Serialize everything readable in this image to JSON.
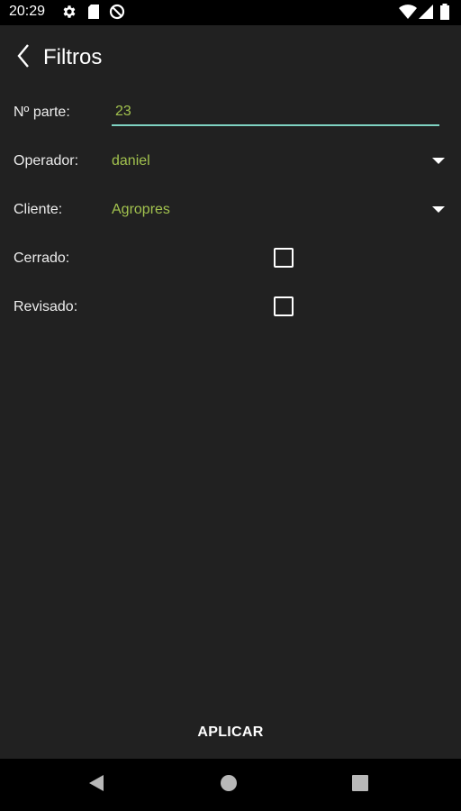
{
  "status_bar": {
    "time": "20:29",
    "icons": [
      "settings-icon",
      "sd-card-icon",
      "no-sync-icon",
      "wifi-icon",
      "signal-icon",
      "battery-icon"
    ]
  },
  "app_bar": {
    "title": "Filtros",
    "back_icon": "arrow-back-icon"
  },
  "form": {
    "part_number": {
      "label": "Nº parte:",
      "value": "23"
    },
    "operator": {
      "label": "Operador:",
      "value": "daniel"
    },
    "client": {
      "label": "Cliente:",
      "value": "Agropres"
    },
    "closed": {
      "label": "Cerrado:",
      "checked": false
    },
    "reviewed": {
      "label": "Revisado:",
      "checked": false
    }
  },
  "actions": {
    "apply_label": "APLICAR"
  },
  "navigation": {
    "buttons": [
      "back-nav-icon",
      "home-nav-icon",
      "recents-nav-icon"
    ]
  },
  "colors": {
    "background": "#212121",
    "value_text": "#a2c24e",
    "input_underline": "#7fd3c2",
    "bars": "#000000"
  }
}
